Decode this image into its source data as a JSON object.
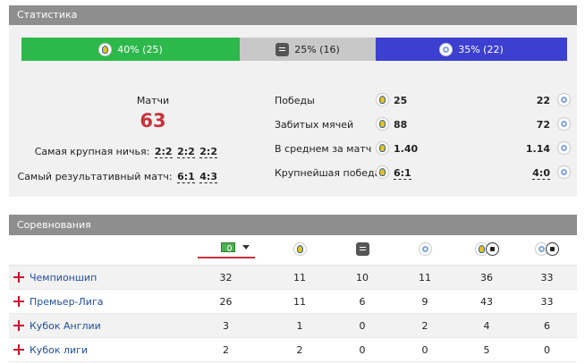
{
  "stats": {
    "title": "Статистика",
    "bar": {
      "home": "40% (25)",
      "draw": "25% (16)",
      "away": "35% (22)"
    },
    "matches_label": "Матчи",
    "matches_value": "63",
    "biggest_draw_label": "Самая крупная ничья:",
    "biggest_draw_values": [
      "2:2",
      "2:2",
      "2:2"
    ],
    "most_goals_label": "Самый результативный матч:",
    "most_goals_values": [
      "6:1",
      "4:3"
    ],
    "rows": [
      {
        "label": "Победы",
        "home": "25",
        "away": "22"
      },
      {
        "label": "Забитых мячей",
        "home": "88",
        "away": "72"
      },
      {
        "label": "В среднем за матч",
        "home": "1.40",
        "away": "1.14"
      },
      {
        "label": "Крупнейшая победа",
        "home": "6:1",
        "away": "4:0"
      }
    ]
  },
  "competitions": {
    "title": "Соревнования",
    "rows": [
      {
        "name": "Чемпионшип",
        "values": [
          "32",
          "11",
          "10",
          "11",
          "36",
          "33"
        ]
      },
      {
        "name": "Премьер-Лига",
        "values": [
          "26",
          "11",
          "6",
          "9",
          "43",
          "33"
        ]
      },
      {
        "name": "Кубок Англии",
        "values": [
          "3",
          "1",
          "0",
          "2",
          "4",
          "6"
        ]
      },
      {
        "name": "Кубок лиги",
        "values": [
          "2",
          "2",
          "0",
          "0",
          "5",
          "0"
        ]
      }
    ]
  }
}
